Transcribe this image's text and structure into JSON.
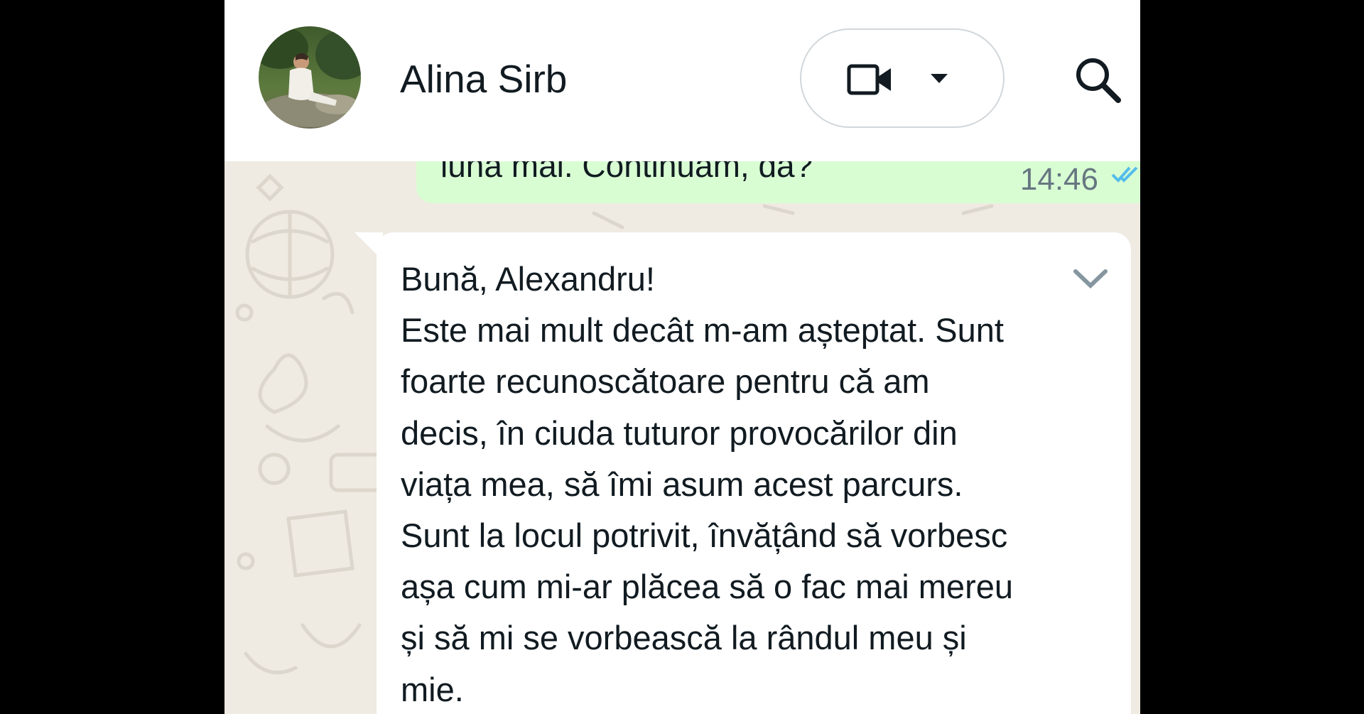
{
  "header": {
    "contact_name": "Alina Sirb",
    "avatar_alt": "Alina Sirb"
  },
  "call_button": {
    "icon": "video-camera-icon",
    "dropdown_icon": "caret-down-icon"
  },
  "search": {
    "icon": "search-icon"
  },
  "outgoing_message": {
    "text_partial": "luna mai. Continuăm, da?",
    "time": "14:46",
    "status_icon": "double-check-icon",
    "status_color": "#53bdeb"
  },
  "incoming_message": {
    "lines": [
      "Bună, Alexandru!",
      "Este mai mult decât m-am așteptat. Sunt",
      "foarte recunoscătoare pentru că am",
      "decis, în ciuda tuturor provocărilor din",
      "viața mea, să îmi asum acest parcurs.",
      "Sunt la locul potrivit, învățând să vorbesc",
      "așa cum mi-ar plăcea să o fac mai mereu",
      "și să mi se vorbească la rândul meu și",
      "mie."
    ],
    "menu_icon": "chevron-down-icon"
  },
  "colors": {
    "outgoing_bubble": "#d9fdd3",
    "incoming_bubble": "#ffffff",
    "wallpaper": "#efeae2",
    "header": "#ffffff"
  }
}
